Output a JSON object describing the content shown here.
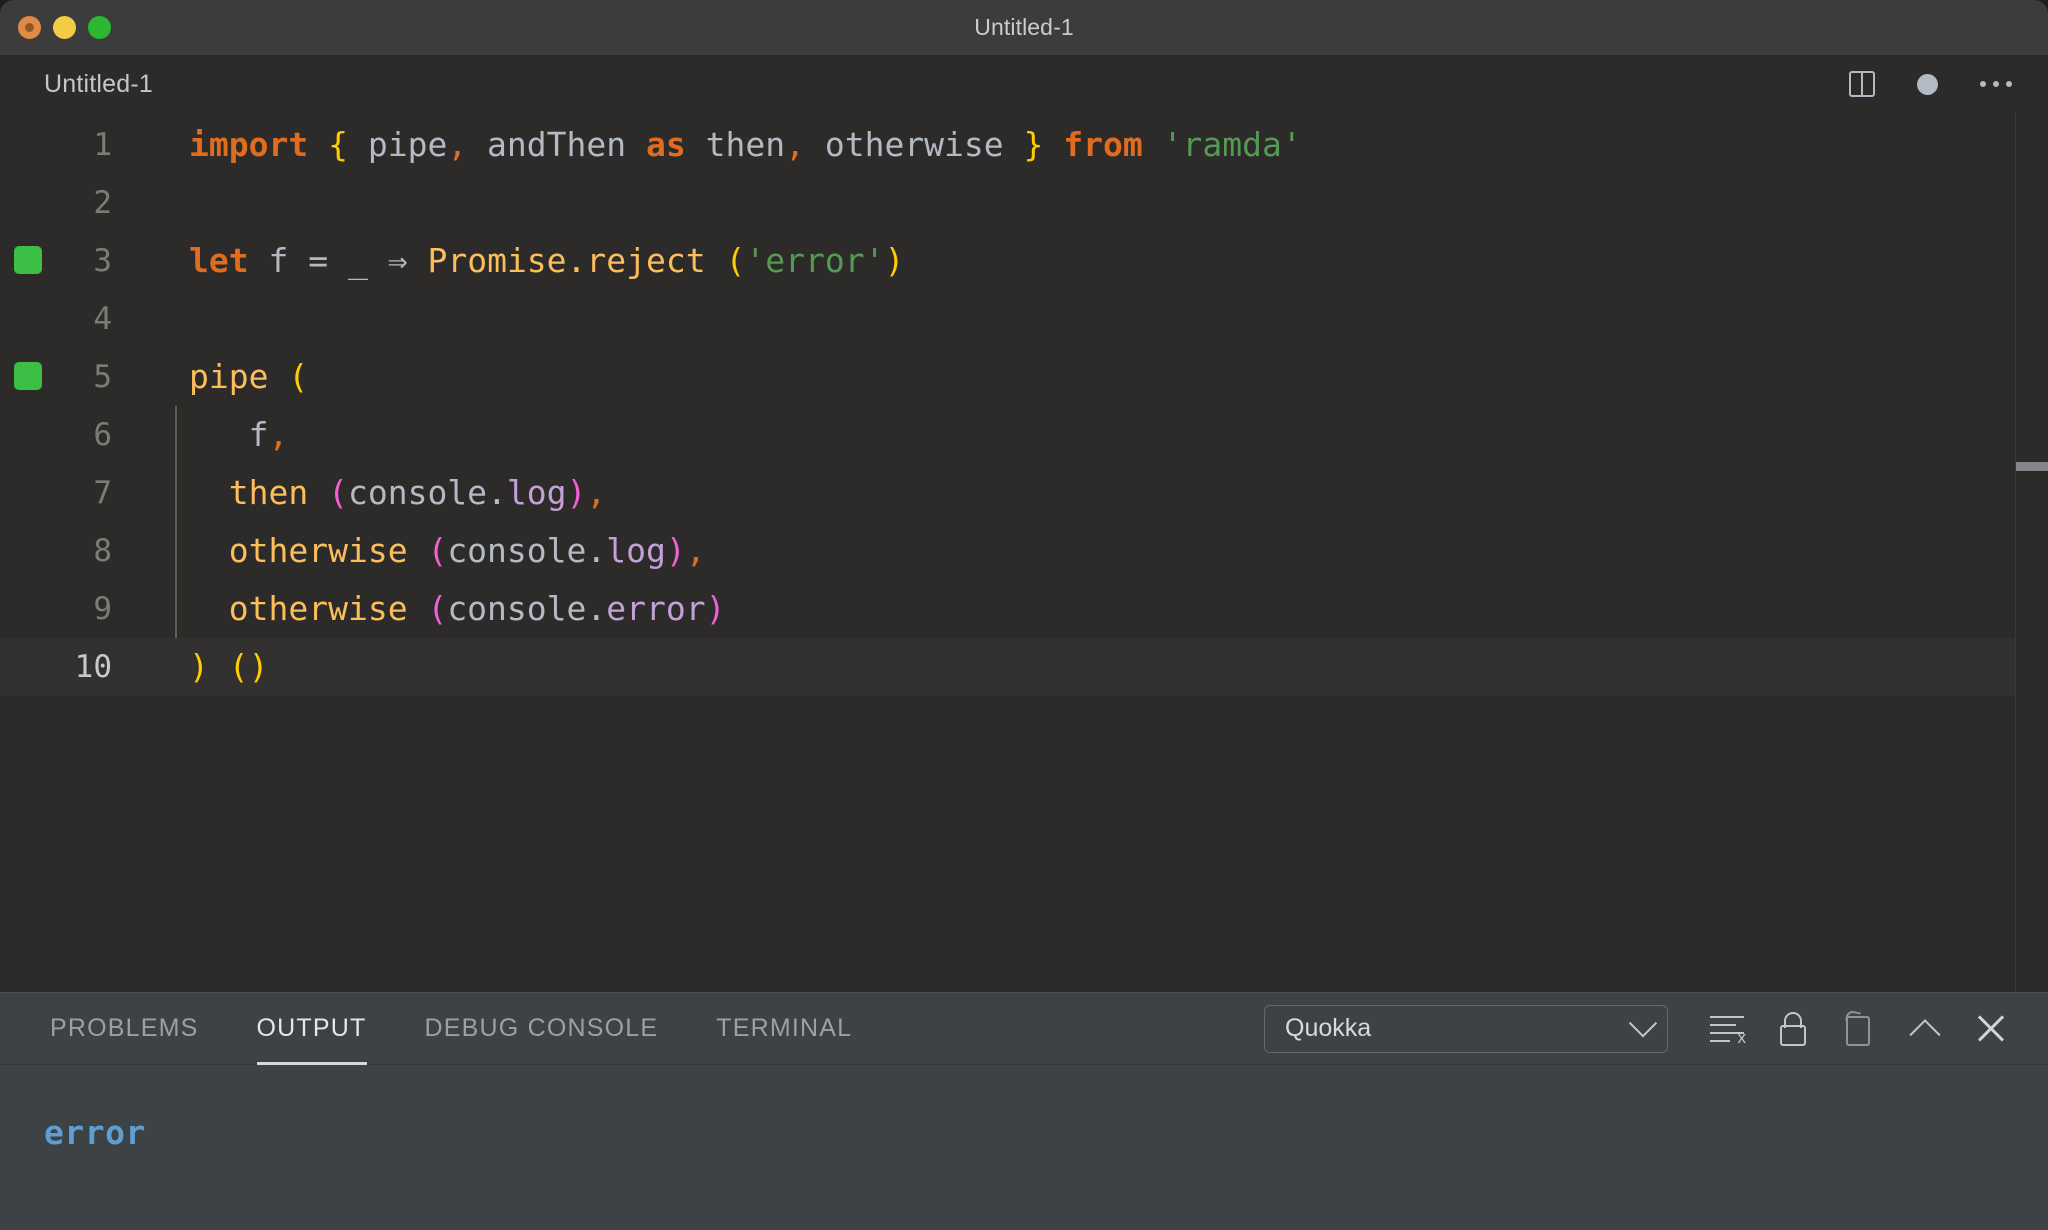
{
  "window": {
    "title": "Untitled-1",
    "traffic_lights": [
      "close-button",
      "minimize-button",
      "maximize-button"
    ]
  },
  "tabbar": {
    "tab_label": "Untitled-1",
    "actions": {
      "split_editor": "split-editor-icon",
      "unsaved_dot": "unsaved-dot-icon",
      "more_actions": "more-actions-icon"
    }
  },
  "editor": {
    "language": "javascript",
    "current_line": 10,
    "breakpoint_lines": [
      3,
      5
    ],
    "lines": [
      {
        "n": "1",
        "mark": false,
        "indent": false
      },
      {
        "n": "2",
        "mark": false,
        "indent": false
      },
      {
        "n": "3",
        "mark": true,
        "indent": false
      },
      {
        "n": "4",
        "mark": false,
        "indent": false
      },
      {
        "n": "5",
        "mark": true,
        "indent": false
      },
      {
        "n": "6",
        "mark": false,
        "indent": true
      },
      {
        "n": "7",
        "mark": false,
        "indent": true
      },
      {
        "n": "8",
        "mark": false,
        "indent": true
      },
      {
        "n": "9",
        "mark": false,
        "indent": true
      },
      {
        "n": "10",
        "mark": false,
        "indent": false
      }
    ],
    "code": {
      "l1": {
        "kw_import": "import",
        "br_open": "{",
        "pipe": " pipe",
        "comma1": ",",
        "andThen": " andThen ",
        "kw_as": "as",
        "then": " then",
        "comma2": ",",
        "otherwise": " otherwise ",
        "br_close": "}",
        "kw_from": " from ",
        "module": "'ramda'"
      },
      "l3": {
        "kw_let": "let",
        "name": " f ",
        "eq": "= ",
        "underscore": "_ ",
        "arrow": "⇒ ",
        "call": "Promise.reject ",
        "paren_open": "(",
        "str": "'error'",
        "paren_close": ")"
      },
      "l5": {
        "fn": "pipe ",
        "paren": "("
      },
      "l6": {
        "name": "f",
        "comma": ","
      },
      "l7": {
        "fn": "then ",
        "p_open": "(",
        "obj": "console.",
        "prop": "log",
        "p_close": ")",
        "comma": ","
      },
      "l8": {
        "fn": "otherwise ",
        "p_open": "(",
        "obj": "console.",
        "prop": "log",
        "p_close": ")",
        "comma": ","
      },
      "l9": {
        "fn": "otherwise ",
        "p_open": "(",
        "obj": "console.",
        "prop": "error",
        "p_close": ")"
      },
      "l10": {
        "close": ")",
        "call_open": " (",
        "call_close": ")"
      }
    }
  },
  "panel": {
    "tabs": [
      {
        "label": "PROBLEMS",
        "active": false
      },
      {
        "label": "OUTPUT",
        "active": true
      },
      {
        "label": "DEBUG CONSOLE",
        "active": false
      },
      {
        "label": "TERMINAL",
        "active": false
      }
    ],
    "channel_select": {
      "value": "Quokka",
      "options": [
        "Quokka"
      ]
    },
    "actions": {
      "clear_output": "clear-output-icon",
      "lock_scroll": "lock-icon",
      "open_in_editor": "open-in-editor-icon",
      "maximize_panel": "chevron-up-icon",
      "close_panel": "close-icon"
    },
    "output_text": "error"
  },
  "colors": {
    "editor_bg": "#2d2b2a",
    "panel_bg": "#3d4245",
    "titlebar_bg": "#3c3c3c",
    "keyword": "#e06c20",
    "function": "#fbbe5b",
    "string": "#559a52",
    "property": "#c3a0d8",
    "plain": "#b3bac4",
    "bracket_outer": "#ffcc00",
    "bracket_inner": "#f260d8",
    "breakpoint_green": "#3cbf45",
    "output_blue": "#5d9fd2"
  }
}
